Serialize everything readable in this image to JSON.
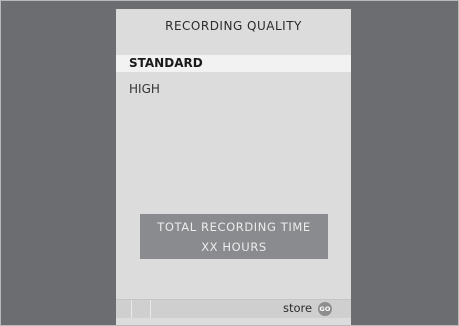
{
  "menu": {
    "title": "RECORDING QUALITY",
    "options": [
      {
        "label": "STANDARD",
        "selected": true
      },
      {
        "label": "HIGH",
        "selected": false
      }
    ]
  },
  "info_box": {
    "line1": "TOTAL RECORDING TIME",
    "line2": "XX HOURS"
  },
  "footer": {
    "store_label": "store",
    "go_icon_text": "GO"
  },
  "colors": {
    "frame_background": "#6c6d70",
    "panel_background": "#dcdcdc",
    "selected_row": "#f2f2f2",
    "info_box": "#8a8b8e"
  }
}
